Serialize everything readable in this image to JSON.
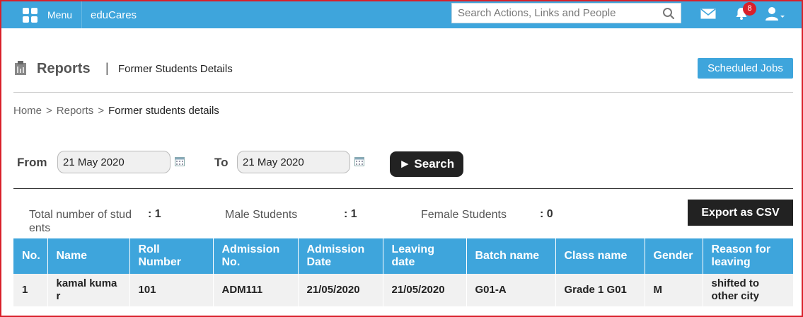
{
  "topbar": {
    "menu_label": "Menu",
    "brand": "eduCares",
    "search_placeholder": "Search Actions, Links and People",
    "notification_count": "8"
  },
  "header": {
    "title": "Reports",
    "separator": "|",
    "subtitle": "Former Students Details",
    "scheduled_jobs_label": "Scheduled Jobs"
  },
  "breadcrumb": {
    "items": [
      "Home",
      "Reports",
      "Former students details"
    ],
    "separator": ">"
  },
  "filter": {
    "from_label": "From",
    "from_value": "21 May 2020",
    "to_label": "To",
    "to_value": "21 May 2020",
    "search_label": "► Search"
  },
  "stats": {
    "total_label": "Total number of stud ents",
    "total_value": ": 1",
    "male_label": "Male Students",
    "male_value": ": 1",
    "female_label": "Female Students",
    "female_value": ": 0",
    "export_label": "Export as CSV"
  },
  "table": {
    "headers": [
      "No.",
      "Name",
      "Roll Number",
      "Admission No.",
      "Admission Date",
      "Leaving date",
      "Batch name",
      "Class name",
      "Gender",
      "Reason for leaving"
    ],
    "rows": [
      [
        "1",
        "kamal kumar",
        "101",
        "ADM111",
        "21/05/2020",
        "21/05/2020",
        "G01-A",
        "Grade 1 G01",
        "M",
        "shifted to other city"
      ]
    ]
  },
  "colors": {
    "accent": "#3ea5dc",
    "dark_button": "#222222",
    "frame": "#d9202a"
  }
}
